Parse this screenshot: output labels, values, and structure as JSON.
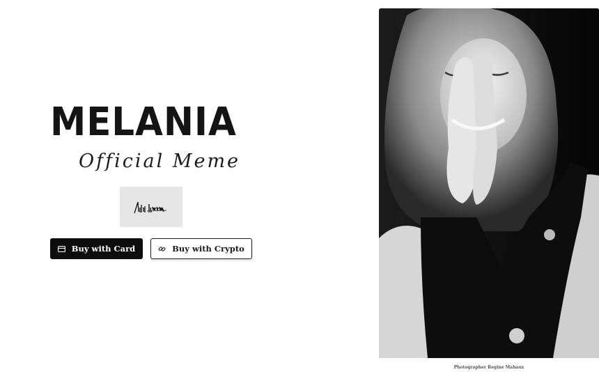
{
  "hero": {
    "title": "MELANIA",
    "subtitle": "Official Meme"
  },
  "signature": {
    "icon": "signature-image"
  },
  "buttons": {
    "card_label": "Buy with Card",
    "card_icon": "credit-card-icon",
    "crypto_label": "Buy with Crypto",
    "crypto_icon": "link-icon"
  },
  "photo": {
    "caption": "Photographer Regine Mahaux"
  },
  "colors": {
    "background": "#ffffff",
    "text": "#141414",
    "card_button": "#0d0d0d",
    "signature_box": "#e6e6e6"
  }
}
